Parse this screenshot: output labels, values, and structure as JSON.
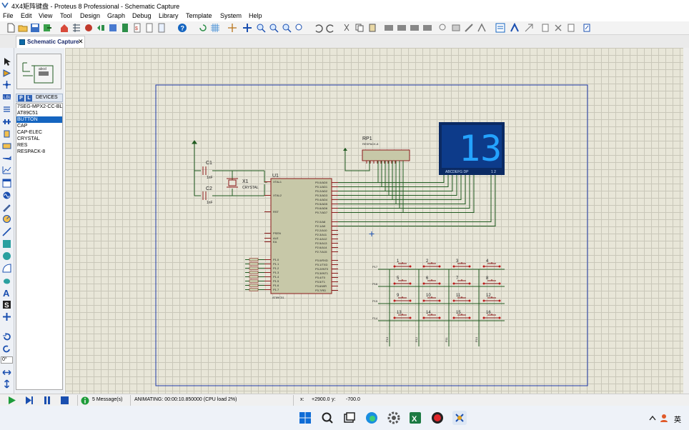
{
  "window": {
    "title": "4X4矩阵键盘 - Proteus 8 Professional - Schematic Capture"
  },
  "menu": [
    "File",
    "Edit",
    "View",
    "Tool",
    "Design",
    "Graph",
    "Debug",
    "Library",
    "Template",
    "System",
    "Help"
  ],
  "tab": {
    "label": "Schematic Capture",
    "close": "✕"
  },
  "devices": {
    "header": "DEVICES",
    "p_label": "P",
    "l_label": "L",
    "items": [
      {
        "label": "7SEG-MPX2-CC-BL",
        "selected": false
      },
      {
        "label": "AT89C51",
        "selected": false
      },
      {
        "label": "BUTTON",
        "selected": true
      },
      {
        "label": "CAP",
        "selected": false
      },
      {
        "label": "CAP-ELEC",
        "selected": false
      },
      {
        "label": "CRYSTAL",
        "selected": false
      },
      {
        "label": "RES",
        "selected": false
      },
      {
        "label": "RESPACK-8",
        "selected": false
      }
    ]
  },
  "rotation": {
    "value": "0°"
  },
  "status": {
    "messages": "5 Message(s)",
    "animating": "ANIMATING: 00:00:10.850000 (CPU load 2%)",
    "x_label": "x:",
    "x_value": "+2900.0",
    "y_label": "y:",
    "y_value": "-700.0"
  },
  "schematic": {
    "display": {
      "value": "13",
      "pins_left": "ABCDEFG DP",
      "pins_right": "1 2"
    },
    "rp1": {
      "ref": "RP1",
      "value": "RESPACK-8"
    },
    "u1": {
      "ref": "U1",
      "part": "AT89C51",
      "left_pins": [
        "XTAL1",
        "XTAL2",
        "RST",
        "PSEN",
        "ALE",
        "EA",
        "P1.0",
        "P1.1",
        "P1.2",
        "P1.3",
        "P1.4",
        "P1.5",
        "P1.6",
        "P1.7"
      ],
      "right_pins": [
        "P0.0/AD0",
        "P0.1/AD1",
        "P0.2/AD2",
        "P0.3/AD3",
        "P0.4/AD4",
        "P0.5/AD5",
        "P0.6/AD6",
        "P0.7/AD7",
        "P2.0/A8",
        "P2.1/A9",
        "P2.2/A10",
        "P2.3/A11",
        "P2.4/A12",
        "P2.5/A13",
        "P2.6/A14",
        "P2.7/A15",
        "P3.0/RXD",
        "P3.1/TXD",
        "P3.2/INT0",
        "P3.3/INT1",
        "P3.4/T0",
        "P3.5/T1",
        "P3.6/WR",
        "P3.7/RD"
      ]
    },
    "c1": {
      "ref": "C1",
      "value": "1nF"
    },
    "c2": {
      "ref": "C2",
      "value": "1nF"
    },
    "x1": {
      "ref": "X1",
      "value": "CRYSTAL"
    },
    "keys": [
      "1",
      "2",
      "3",
      "4",
      "5",
      "6",
      "7",
      "8",
      "9",
      "10",
      "11",
      "12",
      "13",
      "14",
      "15",
      "16"
    ],
    "row_labels": [
      "P17",
      "P16",
      "P15",
      "P14"
    ],
    "col_labels": [
      "P13",
      "P12",
      "P11",
      "P10"
    ]
  },
  "taskbar": {
    "lang": "英"
  },
  "colors": {
    "wire": "#1f5a1f",
    "component": "#8b1a1a",
    "body": "#c7c8a8",
    "display_bg": "#0d3b8a",
    "segment": "#24a3ff"
  }
}
